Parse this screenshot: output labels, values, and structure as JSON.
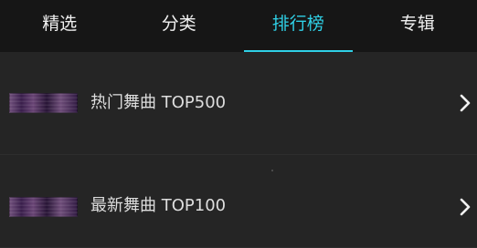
{
  "tabs": [
    {
      "label": "精选",
      "active": false
    },
    {
      "label": "分类",
      "active": false
    },
    {
      "label": "排行榜",
      "active": true
    },
    {
      "label": "专辑",
      "active": false
    }
  ],
  "list": {
    "items": [
      {
        "title": "热门舞曲 TOP500",
        "thumbnail": "playlist-cover-image",
        "icon": "chevron-right-icon"
      },
      {
        "title": "最新舞曲 TOP100",
        "thumbnail": "playlist-cover-image",
        "icon": "chevron-right-icon"
      }
    ]
  },
  "colors": {
    "accent": "#2fd0e6",
    "tabbar_background": "#161616",
    "list_background": "#252525",
    "text": "#dedede"
  }
}
